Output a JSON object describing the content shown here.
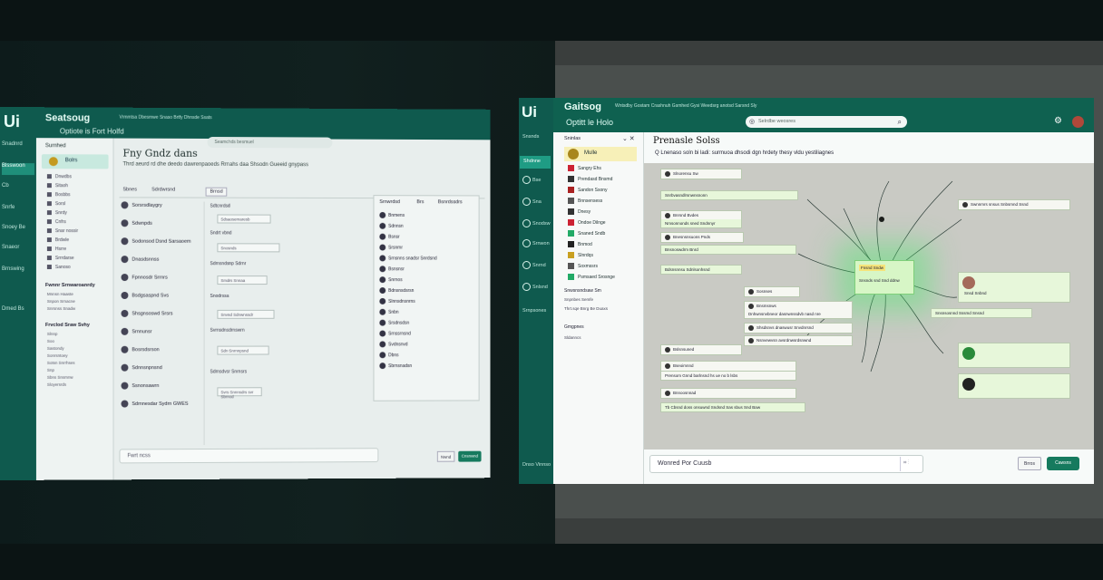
{
  "left": {
    "logo": "Ui",
    "brand": "Seatsoug",
    "subtitle": "Vrmmtsa Dbesmwe Snaso Brtfy  Dhnsde Ssats",
    "project": "Optiote is Fort Holfd",
    "search_placeholder": "Seamchds besmuel",
    "rail": [
      "Snadnrd",
      "Blsswoon",
      "Cb",
      "Snrfe",
      "Snoey Be",
      "Snaeor",
      "Brnswing",
      "Dmed Bs"
    ],
    "sidebar": {
      "header": "Surnhed",
      "selected": "Bolrs",
      "items": [
        "Dnwdbs",
        "Sitaoh",
        "Bosbbs",
        "Sorsl",
        "Snrdy",
        "Cnfrs",
        "Snar nossir",
        "Brdwle",
        "Hsrre",
        "Srrrdarse",
        "Sanoso"
      ],
      "section1": "Fwnnr Srnwaroanrdy",
      "section1_items": [
        "Mnnsn Haaste",
        "Snpon Srnacne",
        "Snrsnss Snadw"
      ],
      "section2": "Frvclod Sraw Svhy",
      "section2_items": [
        "Slnnp",
        "Soo",
        "Sastondy",
        "Sonrsntoey",
        "Sotsn Snrrhses",
        "Snp",
        "Sbns Snsmnw",
        "Sloyersrds"
      ]
    },
    "main": {
      "title": "Fny Gndz dans",
      "desc": "Thrd aeurd rd dhe deedo dawrenpaoeds Rrnahs daa Shsodn Gueeid gnypass",
      "tabs": [
        "Sbnes",
        "Sdrdwrsnd",
        "Brnsd"
      ],
      "list": [
        "Sorsrsdlaygry",
        "Sdwnpds",
        "Sodonsod Dsnd Sarsaoem",
        "Dnasdsnnss",
        "Fpnnosdr Srrnrs",
        "Bsdgsaspnd Svs",
        "Shsgnsoswd Srsrs",
        "Srnnunsr",
        "Bosrsdsrson",
        "Sdnnsnpnsnd",
        "Ssnonsawrn",
        "Sdrnnesdar Sydrn GWES"
      ],
      "middle": [
        "Sdtcnrdsd",
        "Sdsaosemaresb",
        "Sndrt vbnd",
        "Snosnds",
        "Sdrnsndsnp Sdrnr",
        "Smdrs Snnaa",
        "Snodrssa",
        "Snvnd Sdnwnssdr",
        "Svrnsdnsdrnswrn",
        "Sdn Snrnnpsnd",
        "Sdrnsdvsr Snrnsrs",
        "Svrs Snnnsdrs svr Sbrnod"
      ]
    },
    "panel": {
      "header": "Srnwrdsd",
      "header2": "Brs",
      "header3": "Bsnrdssdrs",
      "items": [
        "Bnmens",
        "Sdnnsn",
        "Bsnsr",
        "Srsnmr",
        "Srnsnns snadsr Snrdsnd",
        "Bsnsnsr",
        "Snrnos",
        "Bdnsnsdsrsn",
        "Slnnsdnsnrns",
        "Snbn",
        "Srsdnsdsn",
        "Srnssrnsnd",
        "Svdnsnvd",
        "Dbns",
        "Sbrnsnadsn"
      ]
    },
    "input_placeholder": "Fwrt ncss",
    "btn_secondary": "Nwnd",
    "btn_primary": "Cnsnwnd"
  },
  "right": {
    "logo": "Ui",
    "brand": "Gaitsog",
    "subtitle": "Wntsdby Gostam Crashnuh Gsmhed Gysi    Weedsrg anotsd Sarsnd Sly",
    "project": "Optitt le Holo",
    "search_placeholder": "Selrdbe weosres",
    "rail": [
      "Snsnds",
      "Shdnne",
      "Bse",
      "Sna",
      "Snodsw",
      "Srnwon",
      "Snrnd",
      "Snlsnd",
      "Srnpsones",
      "Dnso Vinnso"
    ],
    "sidebar": {
      "header": "Sninlas",
      "selected": "Mulle",
      "items": [
        "Sangry Ehs",
        "Prendasd Bnsmd",
        "Sandon Ssony",
        "Bnnsensess",
        "Dnesy",
        "Ondoe Dilnge",
        "Snaned Sndb",
        "Bnmod",
        "Slnrdqs",
        "Soxmssrs",
        "Psmsaed Srosnge"
      ],
      "section1": "Snwsnsndsaw Sm",
      "section1_items": [
        "Snpnbes Semfe",
        "Thrt.sqe Bnrg Be Duaxs"
      ],
      "section2": "Gmgpnes",
      "section2_items": [
        "Sldanncs"
      ]
    },
    "main": {
      "title": "Prenasle Solss",
      "desc": "Q Lnenaso soln bi ladi: surmuoa dhsodi dgn hrdety thesy vldu yestiliagnes",
      "hub_tag": "Fnsnd Sndw",
      "hub_text": "Snsnds snd Snd ddnw",
      "nodes_left": [
        "Slnorensu Sw",
        "Snrbvasndlrsnwnsnonn",
        "Bnrsnd Bvdes",
        "Nmsonnonds sned Sndnnyr",
        "Bnesnsnsuons Pnds",
        "Bnsnoswdrm Bnrd",
        "Bdsnsnnsu Sdnlsonhsnd",
        "Sosnses",
        "Bnsmsnws",
        "Dnhwnsnvbneor dasnwnssdvb nasd nre",
        "Shsdsnvs dnaswusr Snvdnrsnd",
        "Nsnvewvsn avsrdnwsrdsnwnd",
        "Bslsnsuned",
        "Bseoimnnd",
        "Prensom Gnnd barlnsnd hs ue no b lsbs",
        "Bnnoosnnad",
        "Tb Cbsnd doss onsuwnd Sndsnd Sas sbus Snd Baw"
      ],
      "nodes_right": [
        "Swnnmrs snsus Snbsmnd Ssnd",
        "Snsd Snbnd",
        "Snsnsosnnd Sssmd Snsnd"
      ]
    },
    "input_placeholder": "Wonred Por Cuusb",
    "btn_secondary": "Brros",
    "btn_primary": "Cawsns"
  }
}
